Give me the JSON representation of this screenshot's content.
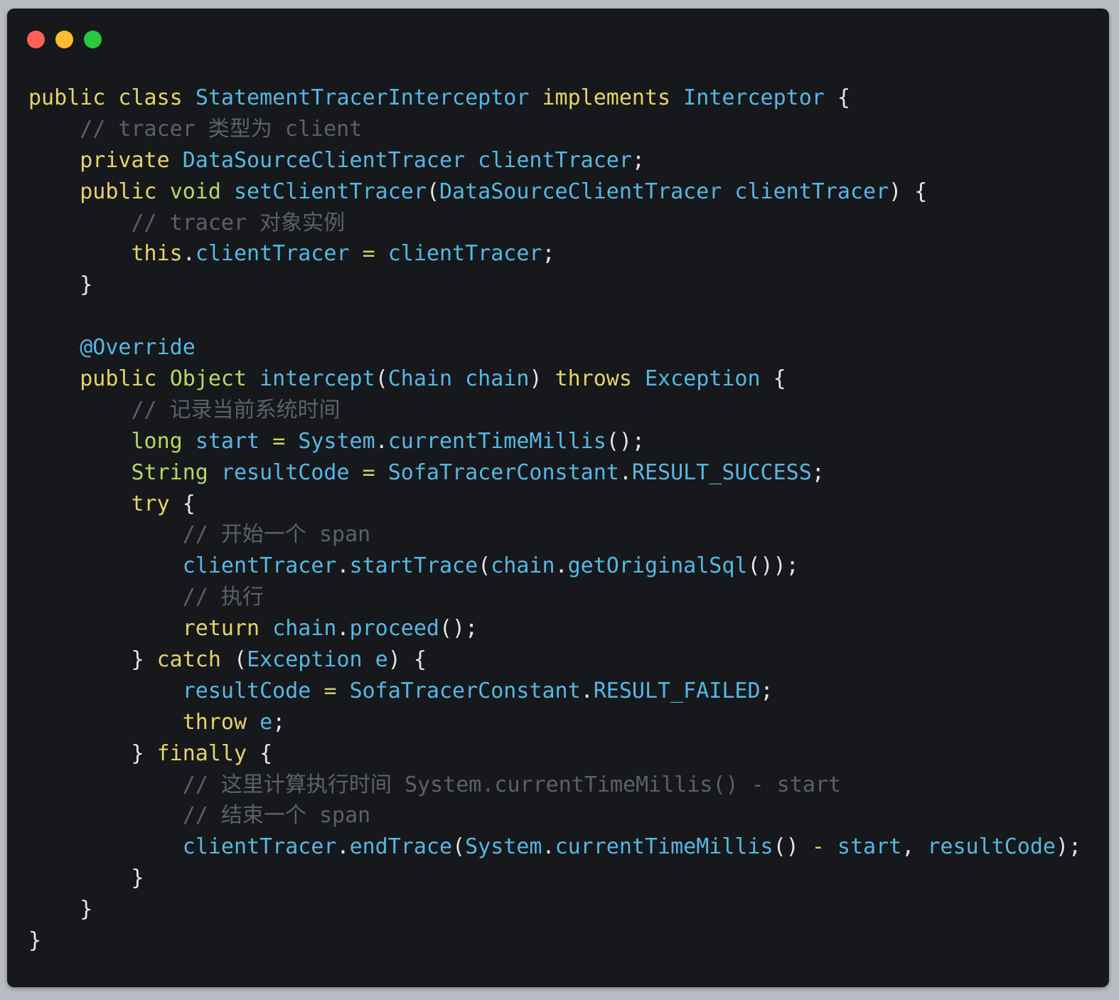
{
  "window": {
    "controls": [
      {
        "name": "close-button",
        "color": "#ff5f57"
      },
      {
        "name": "minimize-button",
        "color": "#febc2e"
      },
      {
        "name": "zoom-button",
        "color": "#28c840"
      }
    ]
  },
  "colors": {
    "keyword": "#e5d36b",
    "type": "#b5d767",
    "identifier": "#56b7e3",
    "plain": "#e6e6e6",
    "comment": "#5c6068",
    "operator": "#d0d060"
  },
  "code": {
    "lines": [
      [
        {
          "t": "public class ",
          "c": "keyword"
        },
        {
          "t": "StatementTracerInterceptor ",
          "c": "identifier"
        },
        {
          "t": "implements ",
          "c": "keyword"
        },
        {
          "t": "Interceptor ",
          "c": "identifier"
        },
        {
          "t": "{",
          "c": "plain"
        }
      ],
      [
        {
          "t": "    ",
          "c": "plain"
        },
        {
          "t": "// tracer 类型为 client",
          "c": "comment"
        }
      ],
      [
        {
          "t": "    ",
          "c": "plain"
        },
        {
          "t": "private ",
          "c": "keyword"
        },
        {
          "t": "DataSourceClientTracer clientTracer",
          "c": "identifier"
        },
        {
          "t": ";",
          "c": "plain"
        }
      ],
      [
        {
          "t": "    ",
          "c": "plain"
        },
        {
          "t": "public ",
          "c": "keyword"
        },
        {
          "t": "void ",
          "c": "type"
        },
        {
          "t": "setClientTracer",
          "c": "identifier"
        },
        {
          "t": "(",
          "c": "plain"
        },
        {
          "t": "DataSourceClientTracer clientTracer",
          "c": "identifier"
        },
        {
          "t": ") {",
          "c": "plain"
        }
      ],
      [
        {
          "t": "        ",
          "c": "plain"
        },
        {
          "t": "// tracer 对象实例",
          "c": "comment"
        }
      ],
      [
        {
          "t": "        ",
          "c": "plain"
        },
        {
          "t": "this",
          "c": "keyword"
        },
        {
          "t": ".",
          "c": "plain"
        },
        {
          "t": "clientTracer ",
          "c": "identifier"
        },
        {
          "t": "= ",
          "c": "operator"
        },
        {
          "t": "clientTracer",
          "c": "identifier"
        },
        {
          "t": ";",
          "c": "plain"
        }
      ],
      [
        {
          "t": "    }",
          "c": "plain"
        }
      ],
      [
        {
          "t": "",
          "c": "plain"
        }
      ],
      [
        {
          "t": "    ",
          "c": "plain"
        },
        {
          "t": "@Override",
          "c": "identifier"
        }
      ],
      [
        {
          "t": "    ",
          "c": "plain"
        },
        {
          "t": "public ",
          "c": "keyword"
        },
        {
          "t": "Object ",
          "c": "type"
        },
        {
          "t": "intercept",
          "c": "identifier"
        },
        {
          "t": "(",
          "c": "plain"
        },
        {
          "t": "Chain chain",
          "c": "identifier"
        },
        {
          "t": ") ",
          "c": "plain"
        },
        {
          "t": "throws ",
          "c": "keyword"
        },
        {
          "t": "Exception ",
          "c": "identifier"
        },
        {
          "t": "{",
          "c": "plain"
        }
      ],
      [
        {
          "t": "        ",
          "c": "plain"
        },
        {
          "t": "// 记录当前系统时间",
          "c": "comment"
        }
      ],
      [
        {
          "t": "        ",
          "c": "plain"
        },
        {
          "t": "long ",
          "c": "type"
        },
        {
          "t": "start ",
          "c": "identifier"
        },
        {
          "t": "= ",
          "c": "operator"
        },
        {
          "t": "System",
          "c": "identifier"
        },
        {
          "t": ".",
          "c": "plain"
        },
        {
          "t": "currentTimeMillis",
          "c": "identifier"
        },
        {
          "t": "();",
          "c": "plain"
        }
      ],
      [
        {
          "t": "        ",
          "c": "plain"
        },
        {
          "t": "String ",
          "c": "type"
        },
        {
          "t": "resultCode ",
          "c": "identifier"
        },
        {
          "t": "= ",
          "c": "operator"
        },
        {
          "t": "SofaTracerConstant",
          "c": "identifier"
        },
        {
          "t": ".",
          "c": "plain"
        },
        {
          "t": "RESULT_SUCCESS",
          "c": "identifier"
        },
        {
          "t": ";",
          "c": "plain"
        }
      ],
      [
        {
          "t": "        ",
          "c": "plain"
        },
        {
          "t": "try ",
          "c": "keyword"
        },
        {
          "t": "{",
          "c": "plain"
        }
      ],
      [
        {
          "t": "            ",
          "c": "plain"
        },
        {
          "t": "// 开始一个 span",
          "c": "comment"
        }
      ],
      [
        {
          "t": "            ",
          "c": "plain"
        },
        {
          "t": "clientTracer",
          "c": "identifier"
        },
        {
          "t": ".",
          "c": "plain"
        },
        {
          "t": "startTrace",
          "c": "identifier"
        },
        {
          "t": "(",
          "c": "plain"
        },
        {
          "t": "chain",
          "c": "identifier"
        },
        {
          "t": ".",
          "c": "plain"
        },
        {
          "t": "getOriginalSql",
          "c": "identifier"
        },
        {
          "t": "());",
          "c": "plain"
        }
      ],
      [
        {
          "t": "            ",
          "c": "plain"
        },
        {
          "t": "// 执行",
          "c": "comment"
        }
      ],
      [
        {
          "t": "            ",
          "c": "plain"
        },
        {
          "t": "return ",
          "c": "keyword"
        },
        {
          "t": "chain",
          "c": "identifier"
        },
        {
          "t": ".",
          "c": "plain"
        },
        {
          "t": "proceed",
          "c": "identifier"
        },
        {
          "t": "();",
          "c": "plain"
        }
      ],
      [
        {
          "t": "        } ",
          "c": "plain"
        },
        {
          "t": "catch ",
          "c": "keyword"
        },
        {
          "t": "(",
          "c": "plain"
        },
        {
          "t": "Exception e",
          "c": "identifier"
        },
        {
          "t": ") {",
          "c": "plain"
        }
      ],
      [
        {
          "t": "            ",
          "c": "plain"
        },
        {
          "t": "resultCode ",
          "c": "identifier"
        },
        {
          "t": "= ",
          "c": "operator"
        },
        {
          "t": "SofaTracerConstant",
          "c": "identifier"
        },
        {
          "t": ".",
          "c": "plain"
        },
        {
          "t": "RESULT_FAILED",
          "c": "identifier"
        },
        {
          "t": ";",
          "c": "plain"
        }
      ],
      [
        {
          "t": "            ",
          "c": "plain"
        },
        {
          "t": "throw ",
          "c": "keyword"
        },
        {
          "t": "e",
          "c": "identifier"
        },
        {
          "t": ";",
          "c": "plain"
        }
      ],
      [
        {
          "t": "        } ",
          "c": "plain"
        },
        {
          "t": "finally ",
          "c": "keyword"
        },
        {
          "t": "{",
          "c": "plain"
        }
      ],
      [
        {
          "t": "            ",
          "c": "plain"
        },
        {
          "t": "// 这里计算执行时间 System.currentTimeMillis() - start",
          "c": "comment"
        }
      ],
      [
        {
          "t": "            ",
          "c": "plain"
        },
        {
          "t": "// 结束一个 span",
          "c": "comment"
        }
      ],
      [
        {
          "t": "            ",
          "c": "plain"
        },
        {
          "t": "clientTracer",
          "c": "identifier"
        },
        {
          "t": ".",
          "c": "plain"
        },
        {
          "t": "endTrace",
          "c": "identifier"
        },
        {
          "t": "(",
          "c": "plain"
        },
        {
          "t": "System",
          "c": "identifier"
        },
        {
          "t": ".",
          "c": "plain"
        },
        {
          "t": "currentTimeMillis",
          "c": "identifier"
        },
        {
          "t": "() ",
          "c": "plain"
        },
        {
          "t": "- ",
          "c": "operator"
        },
        {
          "t": "start",
          "c": "identifier"
        },
        {
          "t": ", ",
          "c": "plain"
        },
        {
          "t": "resultCode",
          "c": "identifier"
        },
        {
          "t": ");",
          "c": "plain"
        }
      ],
      [
        {
          "t": "        }",
          "c": "plain"
        }
      ],
      [
        {
          "t": "    }",
          "c": "plain"
        }
      ],
      [
        {
          "t": "}",
          "c": "plain"
        }
      ]
    ]
  }
}
